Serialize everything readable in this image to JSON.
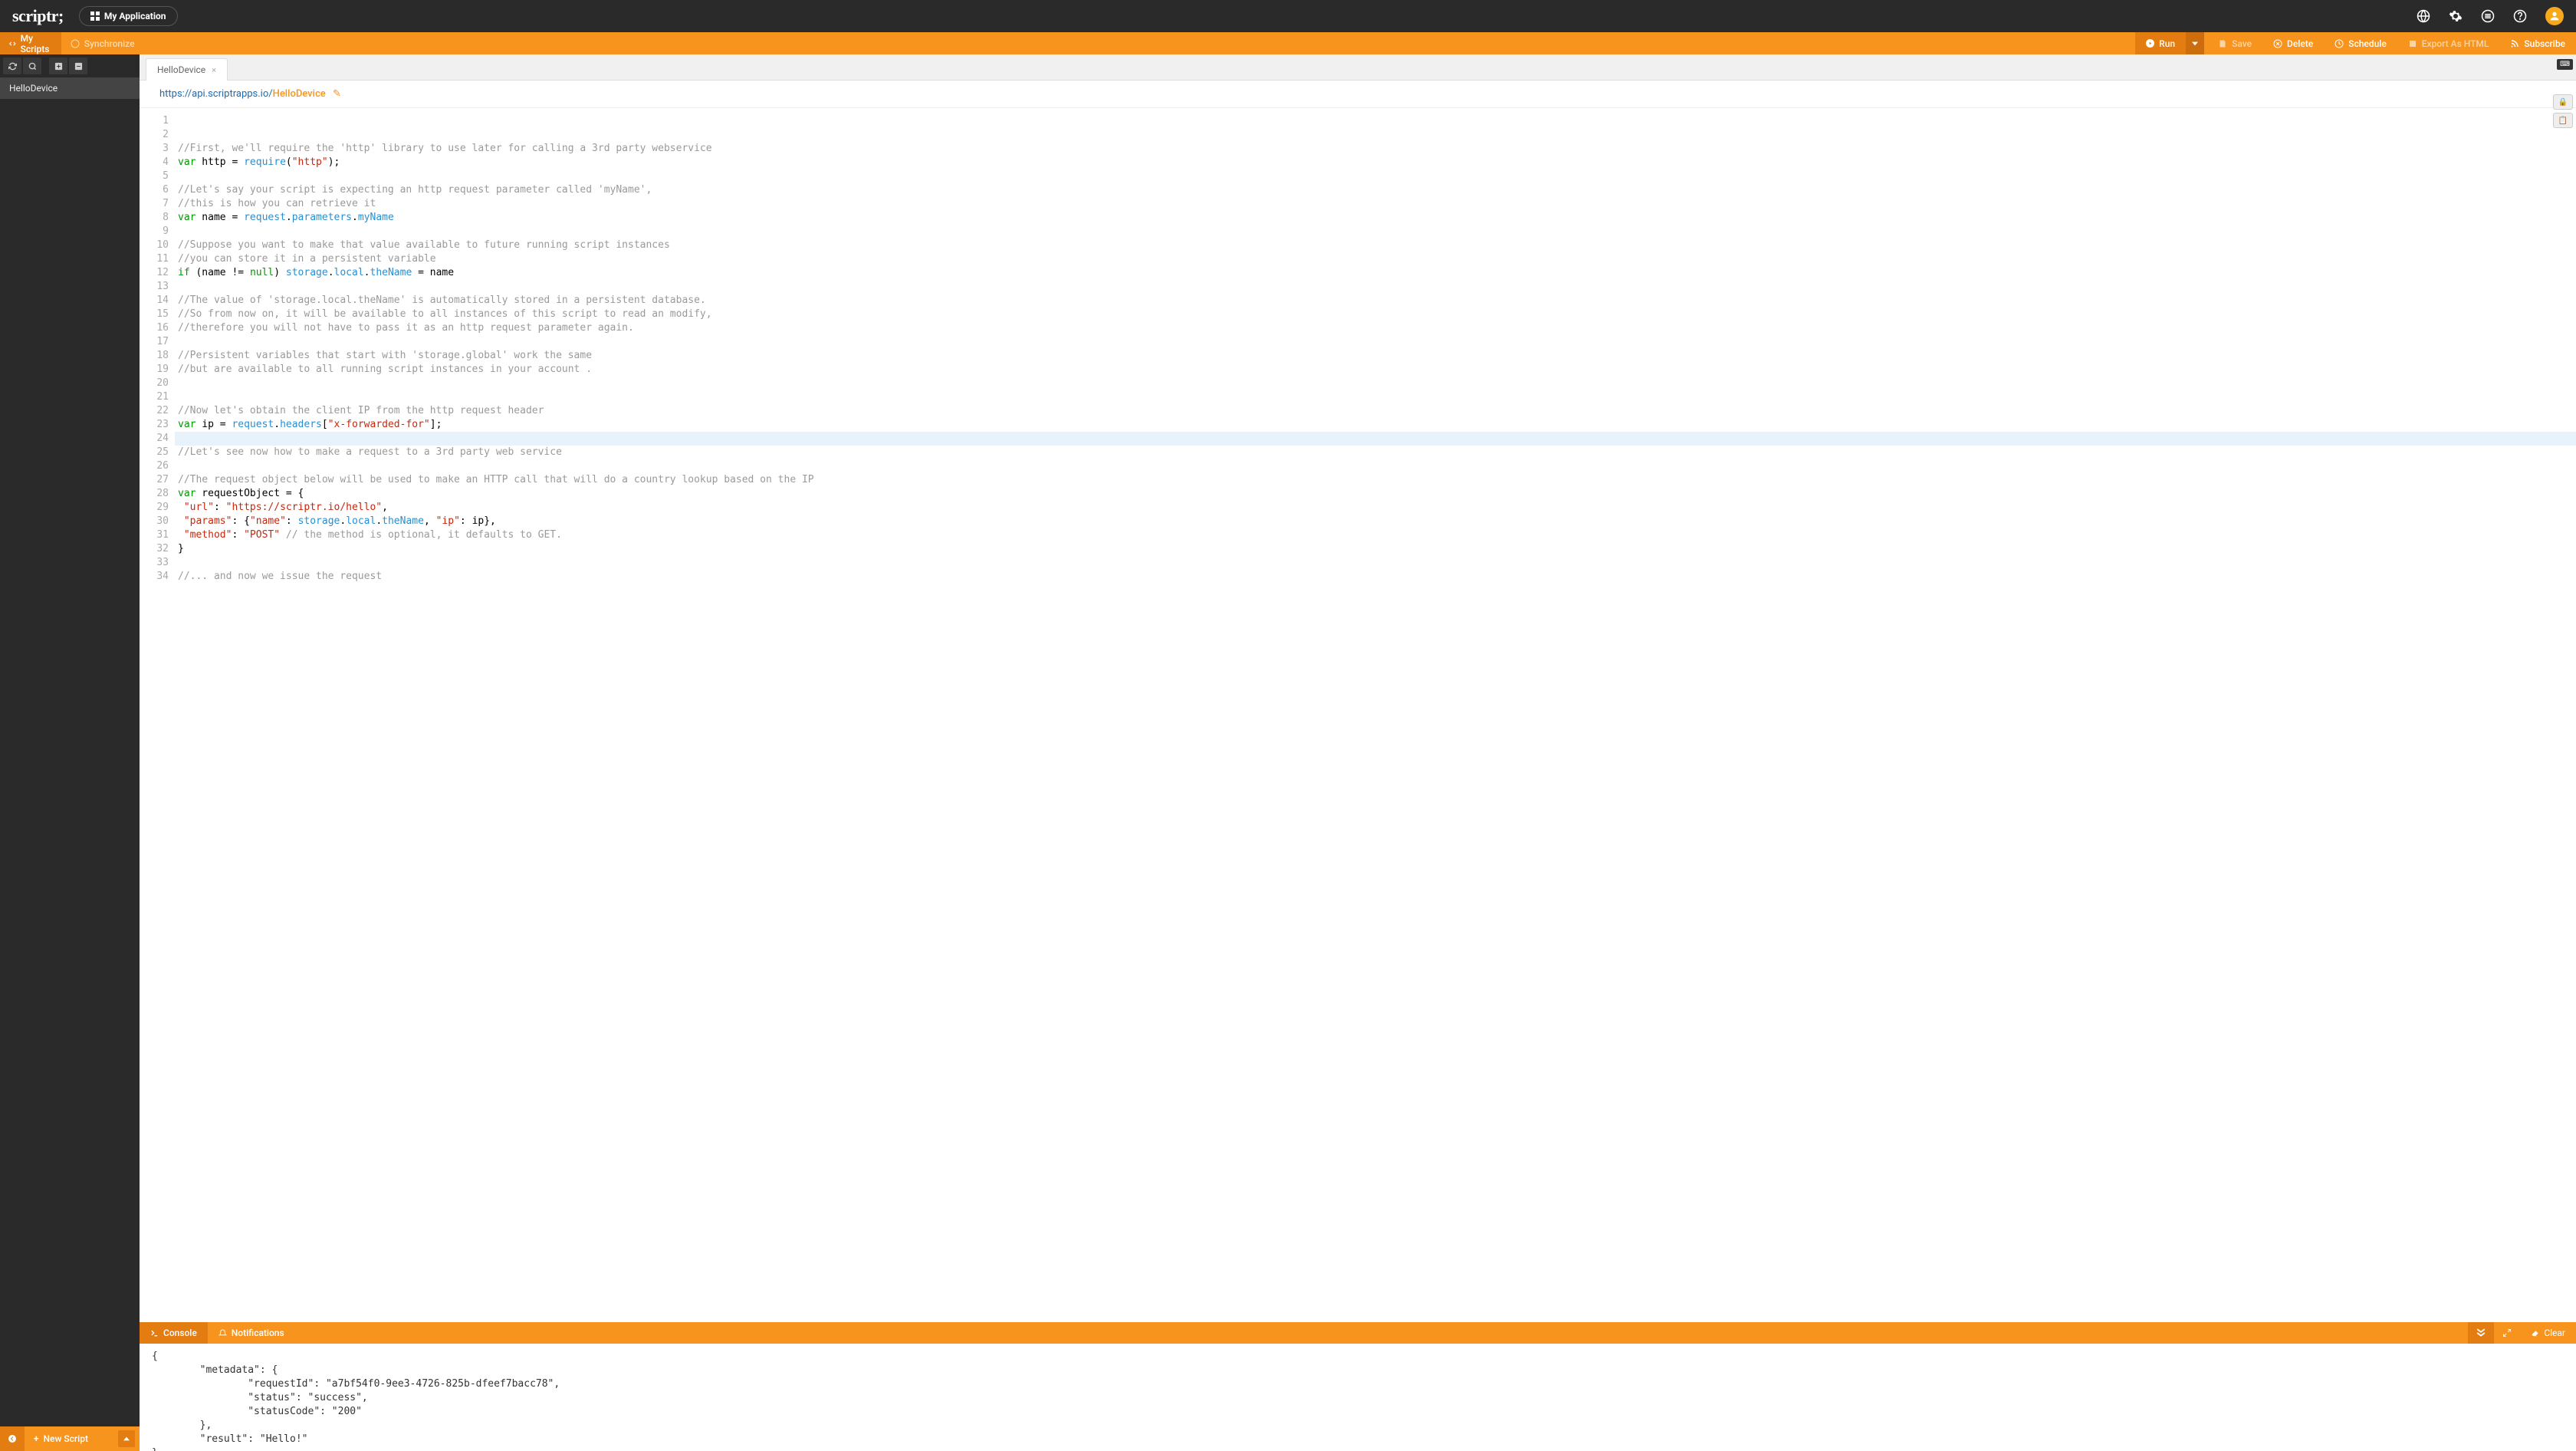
{
  "header": {
    "logo": "scriptr;",
    "app_button": "My Application"
  },
  "tabs": {
    "my_scripts": "My Scripts",
    "synchronize": "Synchronize"
  },
  "actions": {
    "run": "Run",
    "save": "Save",
    "delete": "Delete",
    "schedule": "Schedule",
    "export": "Export As HTML",
    "subscribe": "Subscribe"
  },
  "sidebar": {
    "items": [
      {
        "label": "HelloDevice"
      }
    ],
    "new_script": "New Script"
  },
  "editor": {
    "tab_name": "HelloDevice",
    "url_base": "https://api.scriptrapps.io/",
    "url_path": "HelloDevice",
    "lines": [
      "",
      "",
      "//First, we'll require the 'http' library to use later for calling a 3rd party webservice",
      "var http = require(\"http\");",
      "",
      "//Let's say your script is expecting an http request parameter called 'myName',",
      "//this is how you can retrieve it",
      "var name = request.parameters.myName",
      "",
      "//Suppose you want to make that value available to future running script instances",
      "//you can store it in a persistent variable",
      "if (name != null) storage.local.theName = name",
      "",
      "//The value of 'storage.local.theName' is automatically stored in a persistent database.",
      "//So from now on, it will be available to all instances of this script to read an modify,",
      "//therefore you will not have to pass it as an http request parameter again.",
      "",
      "//Persistent variables that start with 'storage.global' work the same",
      "//but are available to all running script instances in your account .",
      "",
      "",
      "//Now let's obtain the client IP from the http request header",
      "var ip = request.headers[\"x-forwarded-for\"];",
      "",
      "//Let's see now how to make a request to a 3rd party web service",
      "",
      "//The request object below will be used to make an HTTP call that will do a country lookup based on the IP",
      "var requestObject = {",
      " \"url\": \"https://scriptr.io/hello\",",
      " \"params\": {\"name\": storage.local.theName, \"ip\": ip},",
      " \"method\": \"POST\" // the method is optional, it defaults to GET.",
      "}",
      "",
      "//... and now we issue the request"
    ],
    "highlighted_line": 24
  },
  "console": {
    "tab_console": "Console",
    "tab_notifications": "Notifications",
    "clear": "Clear",
    "output": "{\n        \"metadata\": {\n                \"requestId\": \"a7bf54f0-9ee3-4726-825b-dfeef7bacc78\",\n                \"status\": \"success\",\n                \"statusCode\": \"200\"\n        },\n        \"result\": \"Hello!\"\n}"
  }
}
